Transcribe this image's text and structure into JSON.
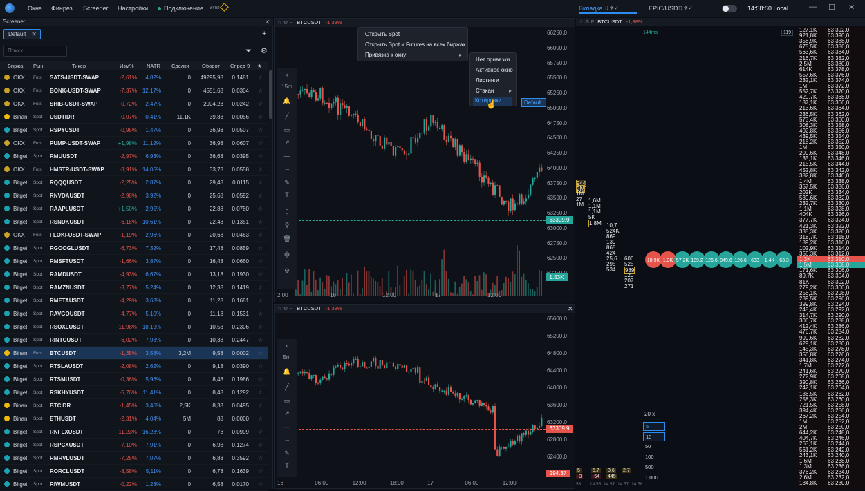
{
  "topbar": {
    "menu": [
      "Окна",
      "Финрез",
      "Screener",
      "Настройки"
    ],
    "connection": "Подключение",
    "tabs": [
      {
        "label": "Вкладка"
      },
      {
        "label": "EPIC/USDT"
      }
    ],
    "clock": "14:58:50 Local"
  },
  "screener": {
    "title": "Screener",
    "tab": "Default",
    "search_placeholder": "Поиск...",
    "columns": [
      "Биржа",
      "Рын",
      "Тикер",
      "Изм%",
      "NATR",
      "Сделки",
      "Оборот",
      "Спред 9"
    ],
    "rows": [
      {
        "ex": "OKX",
        "m": "Futs",
        "t": "SATS-USDT-SWAP",
        "ch": "-2,61%",
        "na": "4,82%",
        "d": "0",
        "tu": "49295,98",
        "sp": "0.1481",
        "c": "#c9a227"
      },
      {
        "ex": "OKX",
        "m": "Futs",
        "t": "BONK-USDT-SWAP",
        "ch": "-7,37%",
        "na": "12,17%",
        "d": "0",
        "tu": "4551,68",
        "sp": "0.0304",
        "c": "#c9a227"
      },
      {
        "ex": "OKX",
        "m": "Futs",
        "t": "SHIB-USDT-SWAP",
        "ch": "-0,72%",
        "na": "2,47%",
        "d": "0",
        "tu": "2004,28",
        "sp": "0.0242",
        "c": "#c9a227"
      },
      {
        "ex": "Binance",
        "m": "Spot",
        "t": "USDTIDR",
        "ch": "-0,07%",
        "na": "0,41%",
        "d": "11,1K",
        "tu": "39,88",
        "sp": "0.0056",
        "c": "#f0b90b"
      },
      {
        "ex": "Bitget",
        "m": "Spot",
        "t": "RSPYUSDT",
        "ch": "-0,95%",
        "na": "1,47%",
        "d": "0",
        "tu": "36,98",
        "sp": "0.0507",
        "c": "#1da2b4"
      },
      {
        "ex": "OKX",
        "m": "Futs",
        "t": "PUMP-USDT-SWAP",
        "ch": "+1,98%",
        "na": "11,12%",
        "d": "0",
        "tu": "36,98",
        "sp": "0.0607",
        "c": "#c9a227"
      },
      {
        "ex": "Bitget",
        "m": "Spot",
        "t": "RMUUSDT",
        "ch": "-2,97%",
        "na": "6,93%",
        "d": "0",
        "tu": "36,68",
        "sp": "0.0395",
        "c": "#1da2b4"
      },
      {
        "ex": "OKX",
        "m": "Futs",
        "t": "HMSTR-USDT-SWAP",
        "ch": "-3,91%",
        "na": "14,05%",
        "d": "0",
        "tu": "33,78",
        "sp": "0.0558",
        "c": "#c9a227"
      },
      {
        "ex": "Bitget",
        "m": "Spot",
        "t": "RQQQUSDT",
        "ch": "-2,25%",
        "na": "2,87%",
        "d": "0",
        "tu": "29,48",
        "sp": "0.0115",
        "c": "#1da2b4"
      },
      {
        "ex": "Bitget",
        "m": "Spot",
        "t": "RNVDAUSDT",
        "ch": "-2,98%",
        "na": "3,92%",
        "d": "0",
        "tu": "25,68",
        "sp": "0.0592",
        "c": "#1da2b4"
      },
      {
        "ex": "Bitget",
        "m": "Spot",
        "t": "RAAPLUSDT",
        "ch": "+1,50%",
        "na": "2,95%",
        "d": "0",
        "tu": "22,88",
        "sp": "0.0780",
        "c": "#1da2b4"
      },
      {
        "ex": "Bitget",
        "m": "Spot",
        "t": "RSNDKUSDT",
        "ch": "-6,18%",
        "na": "10,61%",
        "d": "0",
        "tu": "22,48",
        "sp": "0.1351",
        "c": "#1da2b4"
      },
      {
        "ex": "OKX",
        "m": "Futs",
        "t": "FLOKI-USDT-SWAP",
        "ch": "-1,19%",
        "na": "2,96%",
        "d": "0",
        "tu": "20,68",
        "sp": "0.0463",
        "c": "#c9a227"
      },
      {
        "ex": "Bitget",
        "m": "Spot",
        "t": "RGOOGLUSDT",
        "ch": "-6,73%",
        "na": "7,32%",
        "d": "0",
        "tu": "17,48",
        "sp": "0.0859",
        "c": "#1da2b4"
      },
      {
        "ex": "Bitget",
        "m": "Spot",
        "t": "RMSFTUSDT",
        "ch": "-1,66%",
        "na": "3,87%",
        "d": "0",
        "tu": "16,48",
        "sp": "0.0660",
        "c": "#1da2b4"
      },
      {
        "ex": "Bitget",
        "m": "Spot",
        "t": "RAMDUSDT",
        "ch": "-4,93%",
        "na": "6,67%",
        "d": "0",
        "tu": "13,18",
        "sp": "0.1930",
        "c": "#1da2b4"
      },
      {
        "ex": "Bitget",
        "m": "Spot",
        "t": "RAMZNUSDT",
        "ch": "-3,77%",
        "na": "5,24%",
        "d": "0",
        "tu": "12,38",
        "sp": "0.1419",
        "c": "#1da2b4"
      },
      {
        "ex": "Bitget",
        "m": "Spot",
        "t": "RMETAUSDT",
        "ch": "-4,29%",
        "na": "3,63%",
        "d": "0",
        "tu": "11,28",
        "sp": "0.1681",
        "c": "#1da2b4"
      },
      {
        "ex": "Bitget",
        "m": "Spot",
        "t": "RAVGOUSDT",
        "ch": "-4,77%",
        "na": "5,10%",
        "d": "0",
        "tu": "11,18",
        "sp": "0.1531",
        "c": "#1da2b4"
      },
      {
        "ex": "Bitget",
        "m": "Spot",
        "t": "RSOXLUSDT",
        "ch": "-11,98%",
        "na": "18,19%",
        "d": "0",
        "tu": "10,58",
        "sp": "0.2306",
        "c": "#1da2b4"
      },
      {
        "ex": "Bitget",
        "m": "Spot",
        "t": "RINTCUSDT",
        "ch": "-6,02%",
        "na": "7,93%",
        "d": "0",
        "tu": "10,38",
        "sp": "0.2447",
        "c": "#1da2b4"
      },
      {
        "ex": "Binance",
        "m": "Futs",
        "t": "BTCUSDT",
        "ch": "-1,35%",
        "na": "3,58%",
        "d": "3,2M",
        "tu": "9,58",
        "sp": "0.0002",
        "c": "#f0b90b",
        "sel": true
      },
      {
        "ex": "Bitget",
        "m": "Spot",
        "t": "RTSLAUSDT",
        "ch": "-2,08%",
        "na": "2,62%",
        "d": "0",
        "tu": "9,18",
        "sp": "0.0390",
        "c": "#1da2b4"
      },
      {
        "ex": "Bitget",
        "m": "Spot",
        "t": "RTSMUSDT",
        "ch": "-0,36%",
        "na": "5,96%",
        "d": "0",
        "tu": "8,48",
        "sp": "0.1986",
        "c": "#1da2b4"
      },
      {
        "ex": "Bitget",
        "m": "Spot",
        "t": "RSKHYUSDT",
        "ch": "-5,76%",
        "na": "11,41%",
        "d": "0",
        "tu": "8,48",
        "sp": "0.1292",
        "c": "#1da2b4"
      },
      {
        "ex": "Binance",
        "m": "Spot",
        "t": "BTCIDR",
        "ch": "-1,45%",
        "na": "3,46%",
        "d": "2,5K",
        "tu": "8,38",
        "sp": "0.0495",
        "c": "#f0b90b"
      },
      {
        "ex": "Binance",
        "m": "Spot",
        "t": "ETHUSDT",
        "ch": "-2,31%",
        "na": "4,04%",
        "d": "5M",
        "tu": "88",
        "sp": "0.0000",
        "c": "#f0b90b"
      },
      {
        "ex": "Bitget",
        "m": "Spot",
        "t": "RNFLXUSDT",
        "ch": "-11,23%",
        "na": "16,28%",
        "d": "0",
        "tu": "78",
        "sp": "0.0909",
        "c": "#1da2b4"
      },
      {
        "ex": "Bitget",
        "m": "Spot",
        "t": "RSPCXUSDT",
        "ch": "-7,10%",
        "na": "7,91%",
        "d": "0",
        "tu": "6,98",
        "sp": "0.1274",
        "c": "#1da2b4"
      },
      {
        "ex": "Bitget",
        "m": "Spot",
        "t": "RMRVLUSDT",
        "ch": "-7,25%",
        "na": "7,07%",
        "d": "0",
        "tu": "6,88",
        "sp": "0.3592",
        "c": "#1da2b4"
      },
      {
        "ex": "Bitget",
        "m": "Spot",
        "t": "RORCLUSDT",
        "ch": "-8,58%",
        "na": "5,11%",
        "d": "0",
        "tu": "6,78",
        "sp": "0.1639",
        "c": "#1da2b4"
      },
      {
        "ex": "Bitget",
        "m": "Spot",
        "t": "RIWMUSDT",
        "ch": "-0,22%",
        "na": "1,28%",
        "d": "0",
        "tu": "6,58",
        "sp": "0.0170",
        "c": "#1da2b4"
      }
    ]
  },
  "chart1": {
    "symbol": "BTCUSDT",
    "change": "-1,38%",
    "tf": "15m",
    "prices": [
      "66250.0",
      "66000.0",
      "65750.0",
      "65500.0",
      "65250.0",
      "65000.0",
      "64750.0",
      "64500.0",
      "64250.0",
      "64000.0",
      "63750.0",
      "63500.0",
      "63250.0",
      "63000.0",
      "62750.0",
      "62500.0",
      "62250.0"
    ],
    "last": "63309.9",
    "vol": "1.53K",
    "times": [
      "2:00",
      "16",
      "12:00",
      "17",
      "12:00"
    ]
  },
  "chart2": {
    "symbol": "BTCUSDT",
    "change": "-1,38%",
    "tf": "5m",
    "prices": [
      "65600.0",
      "65200.0",
      "64800.0",
      "64400.0",
      "64000.0",
      "63600.0",
      "63200.0",
      "62800.0",
      "62400.0"
    ],
    "last": "63309.9",
    "low": "294.37",
    "times": [
      "16",
      "06:00",
      "12:00",
      "18:00",
      "17",
      "06:00",
      "12:00"
    ]
  },
  "context_menu": {
    "items": [
      "Открыть Spot",
      "Открыть Spot и Futures на всех биржах",
      "Привязка к окну"
    ],
    "sub": [
      "Нет привязки",
      "Активное окно",
      "Листинги",
      "Стакан",
      "Котировки"
    ],
    "sub2": "Default"
  },
  "dom": {
    "symbol": "BTCUSDT",
    "change": "-1,38%",
    "latency": "144ms",
    "badge": "119",
    "ask_price": "63 310,0",
    "bid_price": "63 308,0",
    "levels": [
      [
        "127,1K",
        "63 392,0"
      ],
      [
        "921,8K",
        "63 390,0"
      ],
      [
        "358,9K",
        "63 388,0"
      ],
      [
        "675,5K",
        "63 386,0"
      ],
      [
        "563,6K",
        "63 384,0"
      ],
      [
        "216,7K",
        "63 382,0"
      ],
      [
        "2,5M",
        "63 380,0"
      ],
      [
        "614K",
        "63 378,0"
      ],
      [
        "557,6K",
        "63 376,0"
      ],
      [
        "232,1K",
        "63 374,0"
      ],
      [
        "1M",
        "63 372,0"
      ],
      [
        "552,7K",
        "63 370,0"
      ],
      [
        "420,7K",
        "63 368,0"
      ],
      [
        "187,1K",
        "63 366,0"
      ],
      [
        "213,6K",
        "63 364,0"
      ],
      [
        "236,5K",
        "63 362,0"
      ],
      [
        "573,4K",
        "63 360,0"
      ],
      [
        "308,3K",
        "63 358,0"
      ],
      [
        "402,8K",
        "63 356,0"
      ],
      [
        "439,5K",
        "63 354,0"
      ],
      [
        "218,2K",
        "63 352,0"
      ],
      [
        "1M",
        "63 350,0"
      ],
      [
        "200,6K",
        "63 348,0"
      ],
      [
        "135,1K",
        "63 346,0"
      ],
      [
        "215,5K",
        "63 344,0"
      ],
      [
        "452,8K",
        "63 342,0"
      ],
      [
        "382,8K",
        "63 340,0"
      ],
      [
        "1,4M",
        "63 338,0"
      ],
      [
        "357,5K",
        "63 336,0"
      ],
      [
        "202K",
        "63 334,0"
      ],
      [
        "539,6K",
        "63 332,0"
      ],
      [
        "232,7K",
        "63 330,0"
      ],
      [
        "1,1M",
        "63 328,0"
      ],
      [
        "404K",
        "63 326,0"
      ],
      [
        "377,7K",
        "63 324,0"
      ],
      [
        "421,3K",
        "63 322,0"
      ],
      [
        "335,3K",
        "63 320,0"
      ],
      [
        "318,7K",
        "63 318,0"
      ],
      [
        "189,2K",
        "63 316,0"
      ],
      [
        "102,9K",
        "63 314,0"
      ],
      [
        "356,3K",
        "63 312,0"
      ],
      [
        "1,3K",
        "63 310,0"
      ],
      [
        "1,5M",
        "63 308,0"
      ],
      [
        "171,6K",
        "63 306,0"
      ],
      [
        "89,7K",
        "63 304,0"
      ],
      [
        "81K",
        "63 302,0"
      ],
      [
        "279,2K",
        "63 300,0"
      ],
      [
        "258,1K",
        "63 298,0"
      ],
      [
        "239,5K",
        "63 296,0"
      ],
      [
        "399,8K",
        "63 294,0"
      ],
      [
        "248,4K",
        "63 292,0"
      ],
      [
        "314,7K",
        "63 290,0"
      ],
      [
        "306,7K",
        "63 288,0"
      ],
      [
        "412,4K",
        "63 286,0"
      ],
      [
        "476,7K",
        "63 284,0"
      ],
      [
        "999,6K",
        "63 282,0"
      ],
      [
        "629,1K",
        "63 280,0"
      ],
      [
        "145,3K",
        "63 278,0"
      ],
      [
        "356,8K",
        "63 276,0"
      ],
      [
        "341,8K",
        "63 274,0"
      ],
      [
        "1,7M",
        "63 272,0"
      ],
      [
        "241,6K",
        "63 270,0"
      ],
      [
        "272,9K",
        "63 268,0"
      ],
      [
        "390,8K",
        "63 266,0"
      ],
      [
        "242,1K",
        "63 264,0"
      ],
      [
        "136,5K",
        "63 262,0"
      ],
      [
        "258,3K",
        "63 260,0"
      ],
      [
        "721,5K",
        "63 258,0"
      ],
      [
        "394,4K",
        "63 256,0"
      ],
      [
        "267,2K",
        "63 254,0"
      ],
      [
        "1M",
        "63 252,0"
      ],
      [
        "2M",
        "63 250,0"
      ],
      [
        "644,2K",
        "63 248,0"
      ],
      [
        "404,7K",
        "63 246,0"
      ],
      [
        "263,1K",
        "63 244,0"
      ],
      [
        "561,2K",
        "63 242,0"
      ],
      [
        "243,1K",
        "63 240,0"
      ],
      [
        "1,6M",
        "63 238,0"
      ],
      [
        "1,3M",
        "63 236,0"
      ],
      [
        "376,2K",
        "63 234,0"
      ],
      [
        "2,6M",
        "63 232,0"
      ],
      [
        "184,8K",
        "63 230,0"
      ]
    ],
    "bubbles": [
      "18,9K",
      "1,3K",
      "57,2K",
      "189,2",
      "126,6",
      "949,6",
      "126,6",
      "633",
      "1,4K",
      "63,3"
    ],
    "size_select": "20 x",
    "sizes": [
      "5",
      "10",
      "50",
      "100",
      "500",
      "1,000"
    ]
  },
  "cluster": {
    "left_col": [
      "944",
      "2M",
      "1M",
      "27",
      "1M"
    ],
    "mid_col": [
      "1,6M",
      "1,1M",
      "1,1M",
      "5K",
      "1,8M"
    ],
    "c2": [
      "10,7",
      "524K",
      "869",
      "139",
      "865",
      "424",
      "25,6",
      "295",
      "534"
    ],
    "c3": [
      "606",
      "525",
      "989",
      "120",
      "207",
      "271"
    ],
    "bottom": [
      "5",
      "5,7",
      "3,6",
      "2,7",
      "-3",
      "-54",
      "445"
    ],
    "times": [
      "53",
      "14:55",
      "14:57",
      "14:57",
      "14:58"
    ]
  }
}
